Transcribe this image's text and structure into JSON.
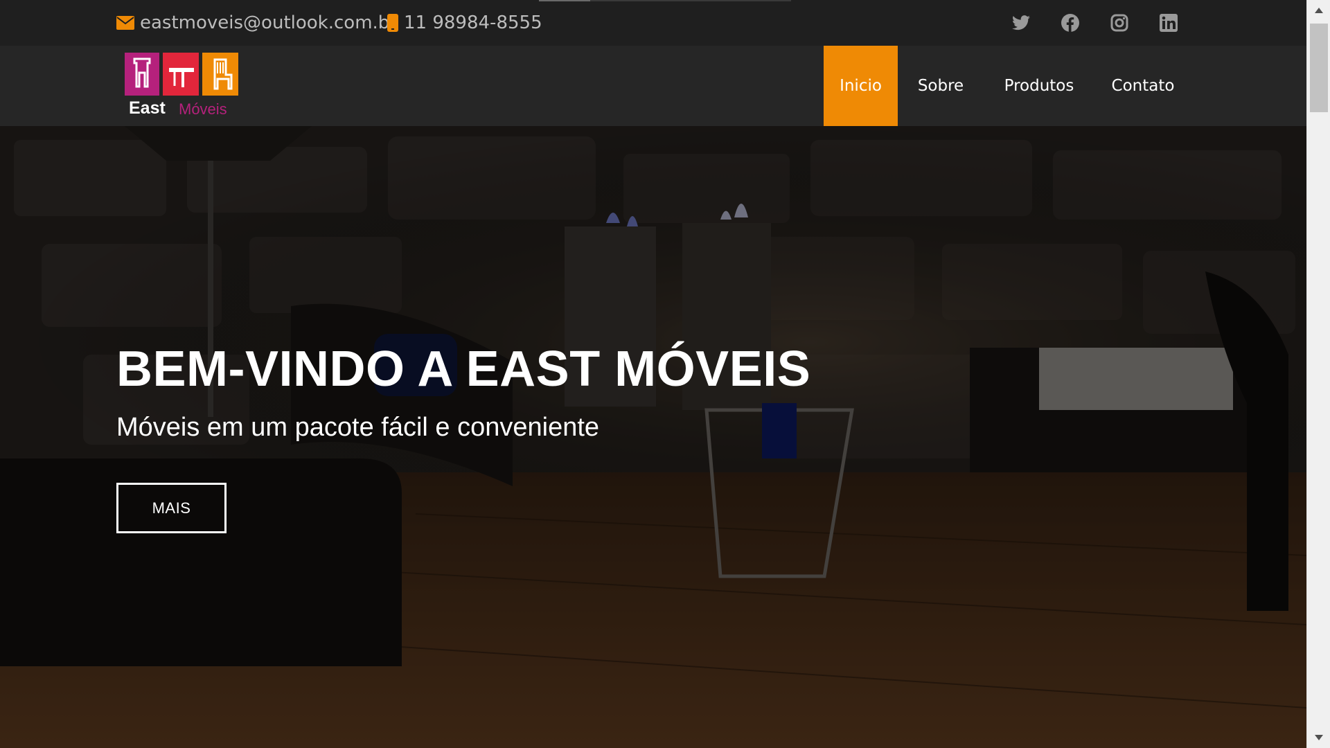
{
  "topbar": {
    "email": "eastmoveis@outlook.com.br",
    "phone": "11 98984-8555",
    "social": [
      "twitter-icon",
      "facebook-icon",
      "instagram-icon",
      "linkedin-icon"
    ]
  },
  "logo": {
    "word1": "East",
    "word2": "Móveis",
    "colors": [
      "#b5217c",
      "#e2263b",
      "#ef8a05"
    ]
  },
  "nav": {
    "items": [
      "Inicio",
      "Sobre",
      "Produtos",
      "Contato"
    ],
    "active": "Inicio",
    "accent": "#ef8a05"
  },
  "hero": {
    "title": "BEM-VINDO A EAST MÓVEIS",
    "subtitle": "Móveis em um pacote fácil e conveniente",
    "button": "MAIS"
  }
}
